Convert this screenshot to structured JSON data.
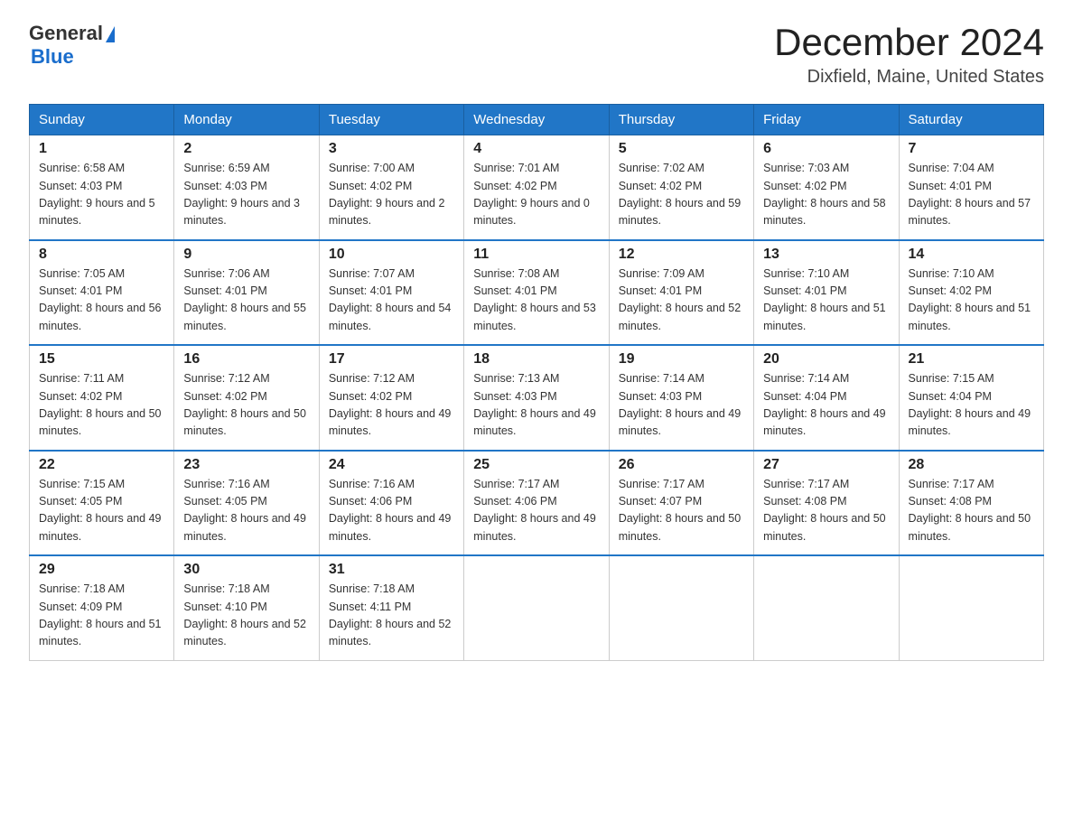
{
  "logo": {
    "general": "General",
    "triangle": "▶",
    "blue": "Blue"
  },
  "title": {
    "month": "December 2024",
    "location": "Dixfield, Maine, United States"
  },
  "weekdays": [
    "Sunday",
    "Monday",
    "Tuesday",
    "Wednesday",
    "Thursday",
    "Friday",
    "Saturday"
  ],
  "weeks": [
    [
      {
        "day": "1",
        "sunrise": "6:58 AM",
        "sunset": "4:03 PM",
        "daylight": "9 hours and 5 minutes."
      },
      {
        "day": "2",
        "sunrise": "6:59 AM",
        "sunset": "4:03 PM",
        "daylight": "9 hours and 3 minutes."
      },
      {
        "day": "3",
        "sunrise": "7:00 AM",
        "sunset": "4:02 PM",
        "daylight": "9 hours and 2 minutes."
      },
      {
        "day": "4",
        "sunrise": "7:01 AM",
        "sunset": "4:02 PM",
        "daylight": "9 hours and 0 minutes."
      },
      {
        "day": "5",
        "sunrise": "7:02 AM",
        "sunset": "4:02 PM",
        "daylight": "8 hours and 59 minutes."
      },
      {
        "day": "6",
        "sunrise": "7:03 AM",
        "sunset": "4:02 PM",
        "daylight": "8 hours and 58 minutes."
      },
      {
        "day": "7",
        "sunrise": "7:04 AM",
        "sunset": "4:01 PM",
        "daylight": "8 hours and 57 minutes."
      }
    ],
    [
      {
        "day": "8",
        "sunrise": "7:05 AM",
        "sunset": "4:01 PM",
        "daylight": "8 hours and 56 minutes."
      },
      {
        "day": "9",
        "sunrise": "7:06 AM",
        "sunset": "4:01 PM",
        "daylight": "8 hours and 55 minutes."
      },
      {
        "day": "10",
        "sunrise": "7:07 AM",
        "sunset": "4:01 PM",
        "daylight": "8 hours and 54 minutes."
      },
      {
        "day": "11",
        "sunrise": "7:08 AM",
        "sunset": "4:01 PM",
        "daylight": "8 hours and 53 minutes."
      },
      {
        "day": "12",
        "sunrise": "7:09 AM",
        "sunset": "4:01 PM",
        "daylight": "8 hours and 52 minutes."
      },
      {
        "day": "13",
        "sunrise": "7:10 AM",
        "sunset": "4:01 PM",
        "daylight": "8 hours and 51 minutes."
      },
      {
        "day": "14",
        "sunrise": "7:10 AM",
        "sunset": "4:02 PM",
        "daylight": "8 hours and 51 minutes."
      }
    ],
    [
      {
        "day": "15",
        "sunrise": "7:11 AM",
        "sunset": "4:02 PM",
        "daylight": "8 hours and 50 minutes."
      },
      {
        "day": "16",
        "sunrise": "7:12 AM",
        "sunset": "4:02 PM",
        "daylight": "8 hours and 50 minutes."
      },
      {
        "day": "17",
        "sunrise": "7:12 AM",
        "sunset": "4:02 PM",
        "daylight": "8 hours and 49 minutes."
      },
      {
        "day": "18",
        "sunrise": "7:13 AM",
        "sunset": "4:03 PM",
        "daylight": "8 hours and 49 minutes."
      },
      {
        "day": "19",
        "sunrise": "7:14 AM",
        "sunset": "4:03 PM",
        "daylight": "8 hours and 49 minutes."
      },
      {
        "day": "20",
        "sunrise": "7:14 AM",
        "sunset": "4:04 PM",
        "daylight": "8 hours and 49 minutes."
      },
      {
        "day": "21",
        "sunrise": "7:15 AM",
        "sunset": "4:04 PM",
        "daylight": "8 hours and 49 minutes."
      }
    ],
    [
      {
        "day": "22",
        "sunrise": "7:15 AM",
        "sunset": "4:05 PM",
        "daylight": "8 hours and 49 minutes."
      },
      {
        "day": "23",
        "sunrise": "7:16 AM",
        "sunset": "4:05 PM",
        "daylight": "8 hours and 49 minutes."
      },
      {
        "day": "24",
        "sunrise": "7:16 AM",
        "sunset": "4:06 PM",
        "daylight": "8 hours and 49 minutes."
      },
      {
        "day": "25",
        "sunrise": "7:17 AM",
        "sunset": "4:06 PM",
        "daylight": "8 hours and 49 minutes."
      },
      {
        "day": "26",
        "sunrise": "7:17 AM",
        "sunset": "4:07 PM",
        "daylight": "8 hours and 50 minutes."
      },
      {
        "day": "27",
        "sunrise": "7:17 AM",
        "sunset": "4:08 PM",
        "daylight": "8 hours and 50 minutes."
      },
      {
        "day": "28",
        "sunrise": "7:17 AM",
        "sunset": "4:08 PM",
        "daylight": "8 hours and 50 minutes."
      }
    ],
    [
      {
        "day": "29",
        "sunrise": "7:18 AM",
        "sunset": "4:09 PM",
        "daylight": "8 hours and 51 minutes."
      },
      {
        "day": "30",
        "sunrise": "7:18 AM",
        "sunset": "4:10 PM",
        "daylight": "8 hours and 52 minutes."
      },
      {
        "day": "31",
        "sunrise": "7:18 AM",
        "sunset": "4:11 PM",
        "daylight": "8 hours and 52 minutes."
      },
      null,
      null,
      null,
      null
    ]
  ]
}
